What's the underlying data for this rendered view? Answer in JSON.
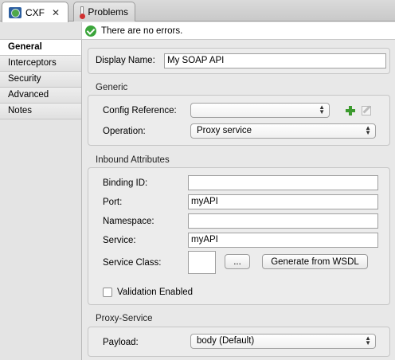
{
  "tabs": [
    {
      "label": "CXF",
      "icon": "cxf-icon",
      "active": true
    },
    {
      "label": "Problems",
      "icon": "problems-icon",
      "active": false
    }
  ],
  "status": {
    "message": "There are no errors.",
    "icon": "check-circle-icon"
  },
  "sidenav": {
    "items": [
      {
        "label": "General",
        "active": true
      },
      {
        "label": "Interceptors",
        "active": false
      },
      {
        "label": "Security",
        "active": false
      },
      {
        "label": "Advanced",
        "active": false
      },
      {
        "label": "Notes",
        "active": false
      }
    ]
  },
  "general": {
    "display_name_label": "Display Name:",
    "display_name_value": "My SOAP API"
  },
  "generic": {
    "title": "Generic",
    "config_ref_label": "Config Reference:",
    "config_ref_value": "",
    "operation_label": "Operation:",
    "operation_value": "Proxy service"
  },
  "inbound": {
    "title": "Inbound Attributes",
    "binding_id_label": "Binding ID:",
    "binding_id_value": "",
    "port_label": "Port:",
    "port_value": "myAPI",
    "namespace_label": "Namespace:",
    "namespace_value": "",
    "service_label": "Service:",
    "service_value": "myAPI",
    "service_class_label": "Service Class:",
    "browse_label": "...",
    "generate_label": "Generate from WSDL",
    "validation_label": "Validation Enabled",
    "validation_checked": false
  },
  "proxy": {
    "title": "Proxy-Service",
    "payload_label": "Payload:",
    "payload_value": "body (Default)"
  },
  "colors": {
    "accent_green": "#3aa53a",
    "tab_active_bg": "#ffffff"
  }
}
